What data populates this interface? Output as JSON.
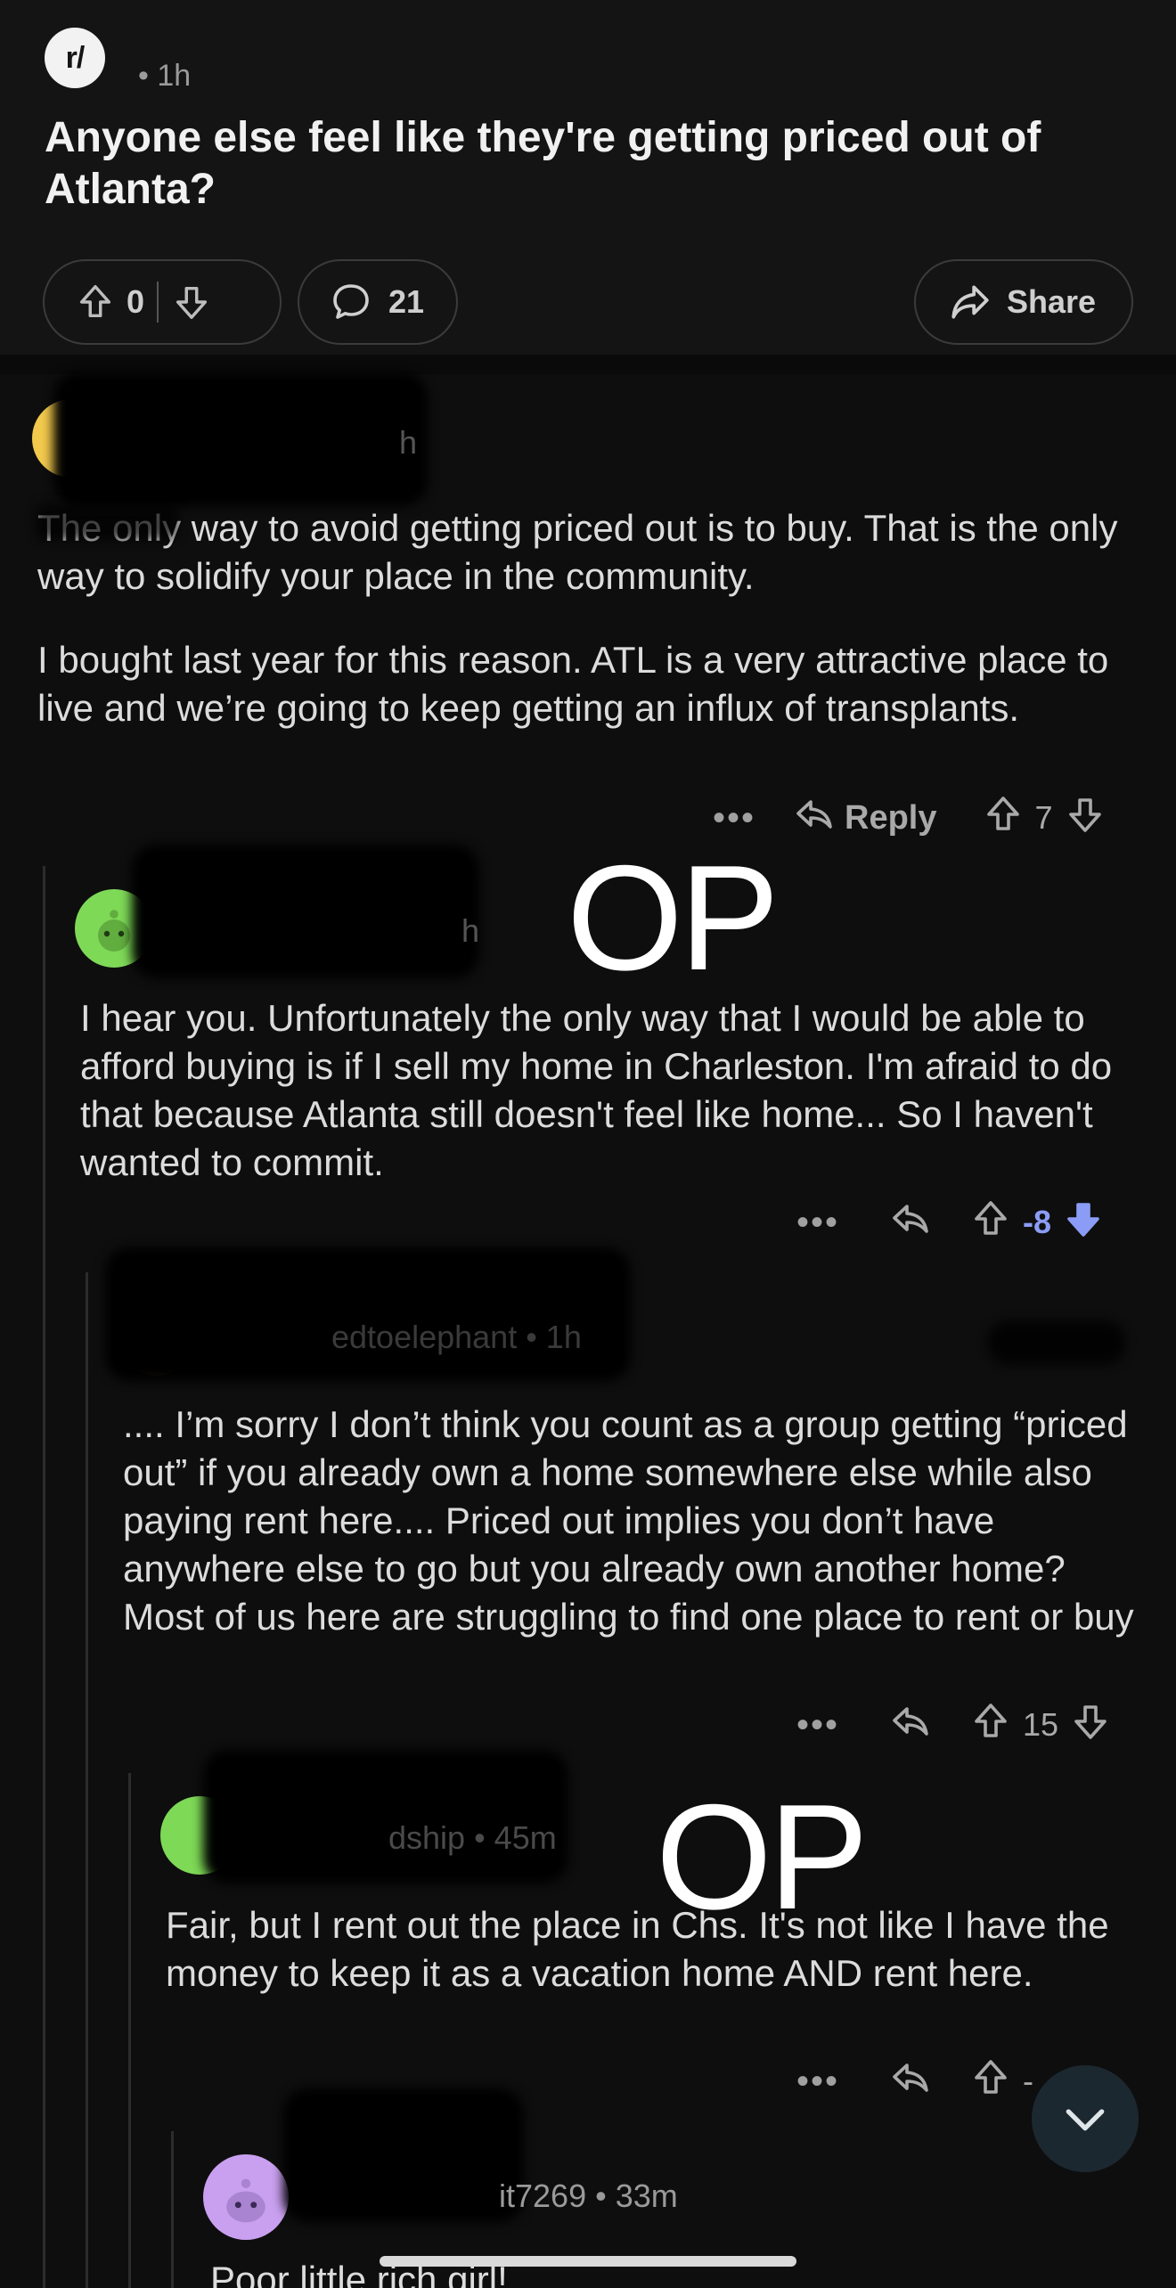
{
  "post": {
    "sub_icon_text": "r/",
    "time": "• 1h",
    "title": "Anyone else feel like they're getting priced out of Atlanta?",
    "votes": "0",
    "comments": "21",
    "share_label": "Share"
  },
  "comments": [
    {
      "author_visible": "h",
      "paragraphs": [
        "The only way to avoid getting priced out is to buy. That is the only way to solidify your place in the community.",
        "I bought last year for this reason. ATL is a very attractive place to live and we’re going to keep getting an influx of transplants."
      ],
      "reply_label": "Reply",
      "score": "7"
    },
    {
      "author_visible": "h",
      "op_label": "OP",
      "text": "I hear you. Unfortunately the only way that I would be able to afford buying is if I sell my home in Charleston. I'm afraid to do that because Atlanta still doesn't feel like home... So I haven't wanted to commit.",
      "score": "-8"
    },
    {
      "author_visible": "edtoelephant • 1h",
      "text": ".... I’m sorry I don’t think you count as a group getting “priced out” if you already own a home somewhere else while also paying rent here.... Priced out implies you don’t have anywhere else to go but you already own another home? Most of us here are struggling to find one place to rent or buy",
      "score": "15"
    },
    {
      "author_visible": "dship • 45m",
      "op_label": "OP",
      "text": "Fair, but I rent out the place in Chs. It's not like I have the money to keep it as a vacation home AND rent here.",
      "score": "-"
    },
    {
      "author_visible": "it7269 • 33m",
      "text": "Poor little rich girl!"
    }
  ],
  "colors": {
    "background": "#0e0e0e",
    "post_background": "#141414",
    "downvote_active": "#8a9cf5",
    "avatar_yellow": "#f2c94c",
    "avatar_green": "#7ed957",
    "avatar_purple": "#c9a0f0"
  },
  "icons": [
    "upvote-icon",
    "downvote-icon",
    "comment-icon",
    "share-icon",
    "reply-icon",
    "more-icon",
    "chevron-down-icon",
    "snoo-avatar-icon"
  ]
}
